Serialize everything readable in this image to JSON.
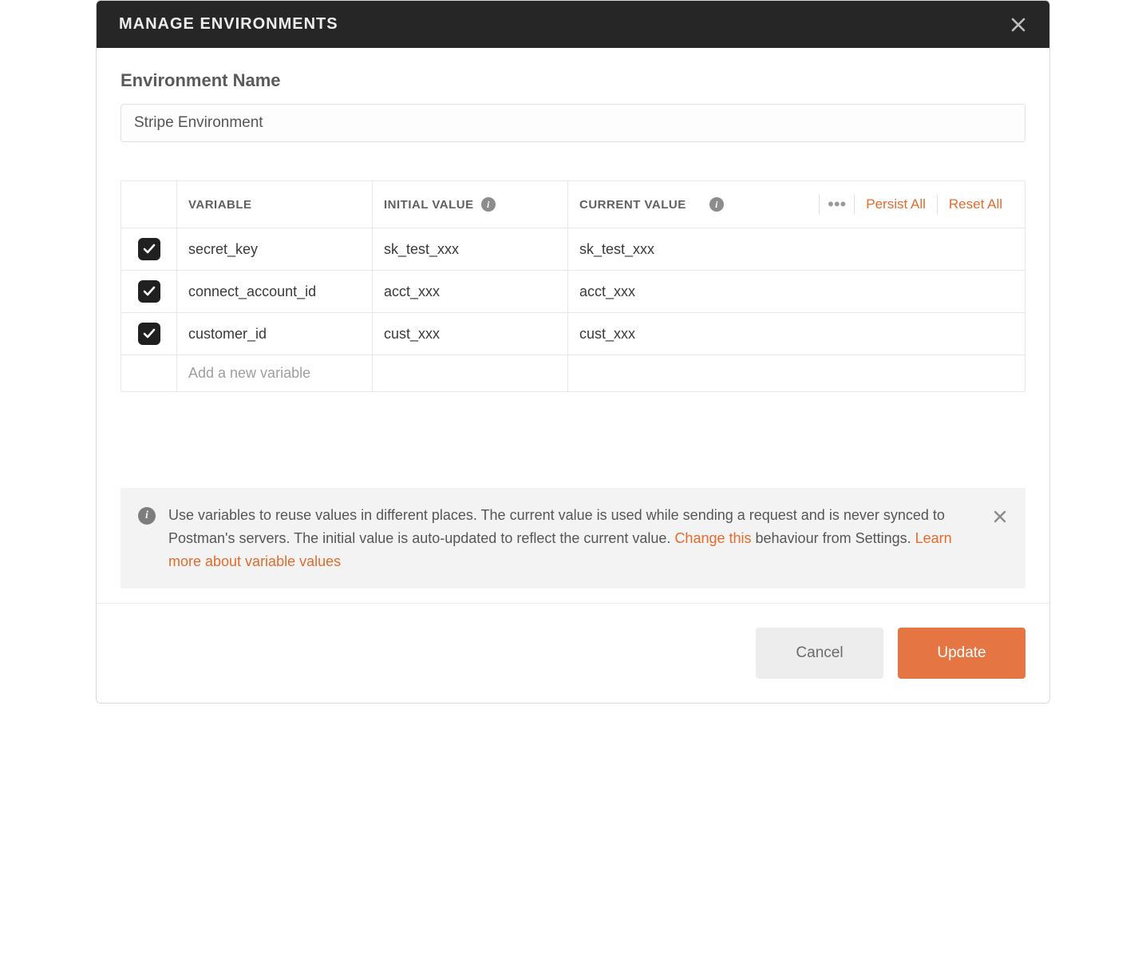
{
  "modal": {
    "title": "MANAGE ENVIRONMENTS"
  },
  "form": {
    "env_name_label": "Environment Name",
    "env_name_value": "Stripe Environment"
  },
  "table": {
    "headers": {
      "variable": "VARIABLE",
      "initial": "INITIAL VALUE",
      "current": "CURRENT VALUE"
    },
    "actions": {
      "persist_all": "Persist All",
      "reset_all": "Reset All"
    },
    "rows": [
      {
        "checked": true,
        "variable": "secret_key",
        "initial": "sk_test_xxx",
        "current": "sk_test_xxx"
      },
      {
        "checked": true,
        "variable": "connect_account_id",
        "initial": "acct_xxx",
        "current": "acct_xxx"
      },
      {
        "checked": true,
        "variable": "customer_id",
        "initial": "cust_xxx",
        "current": "cust_xxx"
      }
    ],
    "new_row_placeholder": "Add a new variable"
  },
  "banner": {
    "text_1": "Use variables to reuse values in different places. The current value is used while sending a request and is never synced to Postman's servers. The initial value is auto-updated to reflect the current value. ",
    "link_change": "Change this",
    "text_2": " behaviour from Settings. ",
    "link_learn": "Learn more about variable values"
  },
  "footer": {
    "cancel": "Cancel",
    "update": "Update"
  }
}
